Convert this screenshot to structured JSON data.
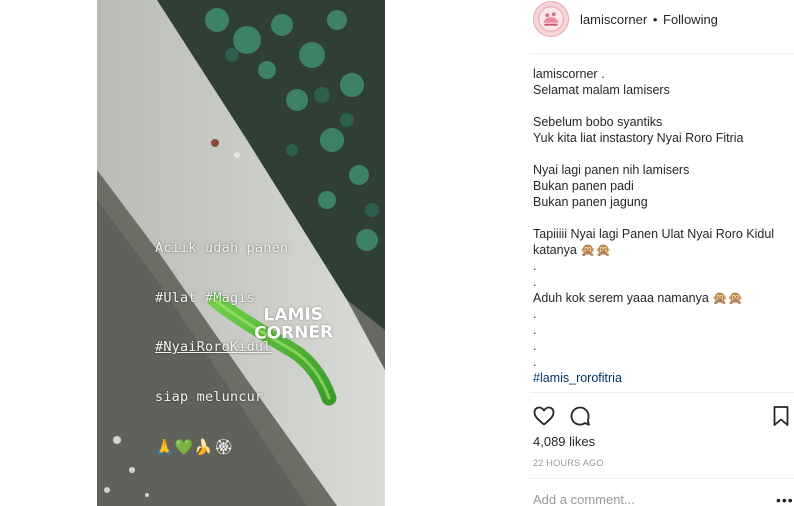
{
  "post": {
    "story_text": {
      "lines": [
        "Aciik udah panen",
        "#Ulat #Magis",
        "#NyaiRoroKidul",
        "siap meluncur"
      ],
      "emojis": "🙏💚🍌🏵"
    },
    "watermark": {
      "line1": "LAMIS",
      "line2": "CORNER"
    }
  },
  "header": {
    "username": "lamiscorner",
    "separator": "•",
    "follow_state": "Following"
  },
  "caption": {
    "username": "lamiscorner",
    "lines": [
      " .",
      "Selamat malam lamisers",
      "",
      "Sebelum bobo syantiks",
      "Yuk kita liat instastory Nyai Roro Fitria",
      "",
      "Nyai lagi panen nih lamisers",
      "Bukan panen padi",
      "Bukan panen jagung",
      "",
      "Tapiiiii Nyai lagi Panen Ulat Nyai Roro Kidul",
      "katanya 🙊🙊",
      ".",
      ".",
      "Aduh kok serem yaaa namanya 🙊🙊",
      ".",
      ".",
      ".",
      "."
    ],
    "hashtag": "#lamis_rorofitria"
  },
  "actions": {
    "like_icon": "heart-outline-icon",
    "comment_icon": "comment-bubble-icon",
    "save_icon": "bookmark-icon"
  },
  "likes": "4,089 likes",
  "timestamp": "22 HOURS AGO",
  "comment": {
    "placeholder": "Add a comment...",
    "more_label": "•••"
  }
}
